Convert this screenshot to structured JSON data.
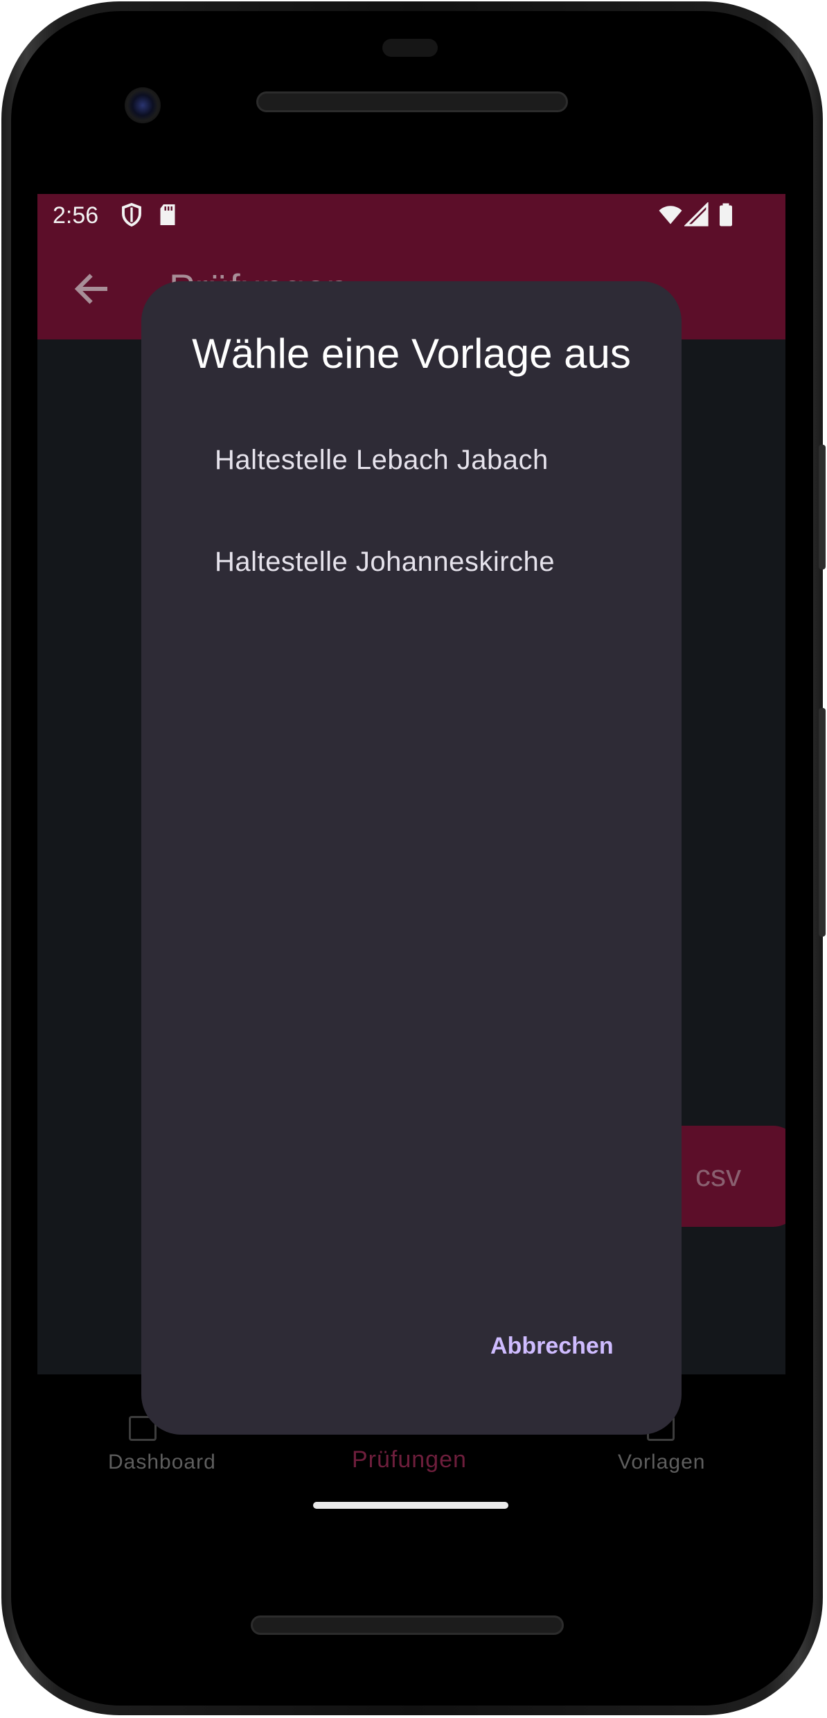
{
  "status_bar": {
    "time": "2:56",
    "left_icons": [
      "shield-icon",
      "sd-card-icon"
    ],
    "right_icons": [
      "wifi-icon",
      "cellular-signal-icon",
      "battery-icon"
    ]
  },
  "app_bar": {
    "title": "Prüfungen",
    "back_icon": "arrow-left-icon"
  },
  "background_button": {
    "label": "csv"
  },
  "bottom_nav": {
    "items": [
      {
        "label": "Dashboard",
        "icon": "dashboard-icon",
        "active": false
      },
      {
        "label": "Prüfungen",
        "icon": "checklist-icon",
        "active": true
      },
      {
        "label": "Vorlagen",
        "icon": "template-icon",
        "active": false
      }
    ]
  },
  "dialog": {
    "title": "Wähle eine Vorlage aus",
    "options": [
      "Haltestelle Lebach Jabach",
      "Haltestelle Johanneskirche"
    ],
    "cancel_label": "Abbrechen"
  },
  "colors": {
    "primary": "#5c0e29",
    "surface": "#14171b",
    "dialog_background": "#2e2b36",
    "accent_text": "#cfbcff"
  }
}
